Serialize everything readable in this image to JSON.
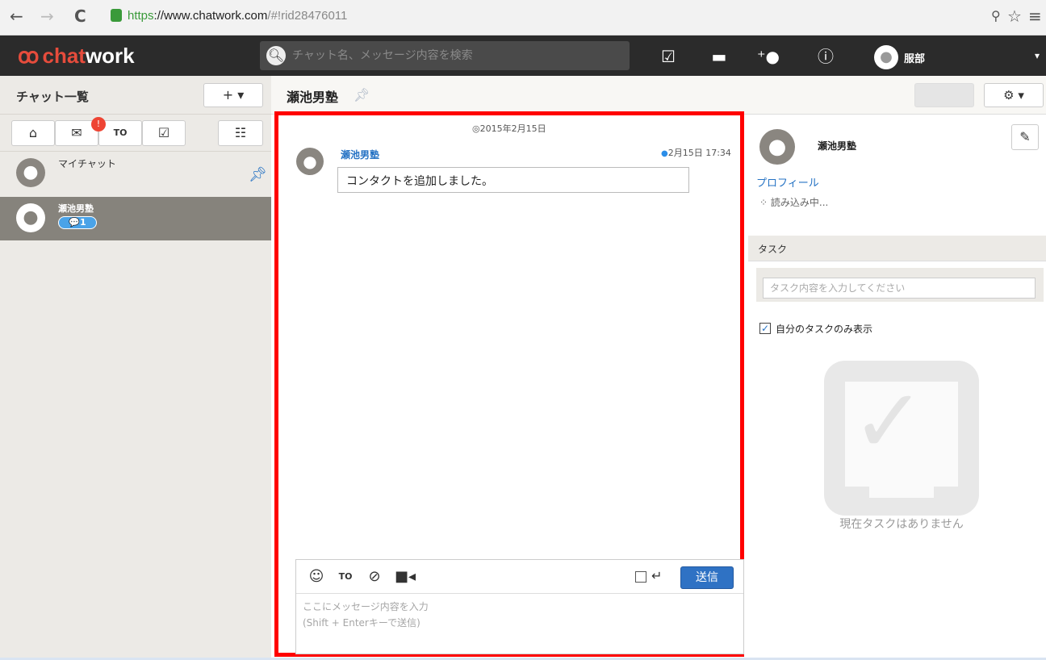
{
  "browser": {
    "back": "←",
    "forward": "→",
    "reload": "C",
    "url_scheme": "https",
    "url_host": "://www.chatwork.com",
    "url_path": "/#!rid28476011",
    "key_icon": "key-icon",
    "star_icon": "☆",
    "menu_icon": "≡"
  },
  "topbar": {
    "logo_mark": "ꝏ",
    "logo_chat": "chat",
    "logo_work": "work",
    "search_placeholder": "チャット名、メッセージ内容を検索",
    "username": "服部"
  },
  "left": {
    "title": "チャット一覧",
    "add_label": "+ ▾",
    "badge_count": "!",
    "rooms": [
      {
        "name": "マイチャット"
      },
      {
        "name": "瀬池男塾",
        "unread": "💬1"
      }
    ]
  },
  "center": {
    "room_title": "瀬池男塾",
    "date_separator": "◎2015年2月15日",
    "message": {
      "sender": "瀬池男塾",
      "time": "2月15日 17:34",
      "text": "コンタクトを追加しました。"
    },
    "composer": {
      "send_label": "送信",
      "placeholder": "ここにメッセージ内容を入力\n(Shift + Enterキーで送信)"
    }
  },
  "right": {
    "name": "瀬池男塾",
    "profile_link": "プロフィール",
    "loading": "読み込み中...",
    "task_header": "タスク",
    "task_placeholder": "タスク内容を入力してください",
    "my_tasks_only": "自分のタスクのみ表示",
    "empty_text": "現在タスクはありません"
  },
  "colors": {
    "accent_blue": "#2673c4",
    "logo_red": "#e64c3c",
    "highlight_red": "#ff0000",
    "topbar_bg": "#2b2b2b"
  }
}
